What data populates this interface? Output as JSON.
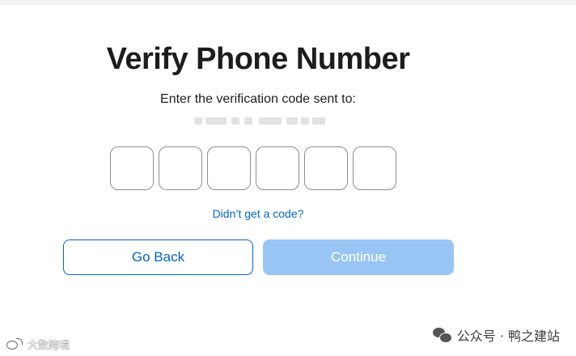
{
  "page": {
    "title": "Verify Phone Number",
    "subtitle": "Enter the verification code sent to:",
    "phone_number_redacted": true
  },
  "code_input": {
    "digit_count": 6,
    "digits": [
      "",
      "",
      "",
      "",
      "",
      ""
    ]
  },
  "links": {
    "resend": "Didn’t get a code?"
  },
  "buttons": {
    "back_label": "Go Back",
    "continue_label": "Continue",
    "continue_enabled": false
  },
  "watermarks": {
    "right_text": "公众号 · 鸭之建站",
    "left_text": "大数跨境"
  },
  "colors": {
    "accent": "#0066cc",
    "continue_disabled_bg": "#99c5f5",
    "title_text": "#1d1d1f",
    "input_border": "#8e8e93"
  },
  "icons": {
    "watermark_right": "wechat-icon",
    "watermark_left": "weibo-icon"
  }
}
